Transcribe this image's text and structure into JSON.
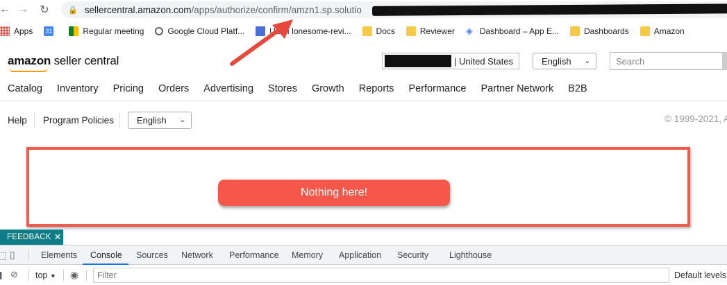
{
  "browser": {
    "url_host": "sellercentral.amazon.com",
    "url_path": "/apps/authorize/confirm/amzn1.sp.solutio"
  },
  "bookmarks": [
    {
      "label": "Apps",
      "icon": "apps-grid-icon"
    },
    {
      "label": "",
      "icon": "calendar-icon"
    },
    {
      "label": "Regular meeting",
      "icon": "google-meet-icon"
    },
    {
      "label": "Google Cloud Platf...",
      "icon": "google-cloud-icon"
    },
    {
      "label": "USUI lonesome-revi...",
      "icon": "usui-icon"
    },
    {
      "label": "Docs",
      "icon": "folder-icon"
    },
    {
      "label": "Reviewer",
      "icon": "folder-icon"
    },
    {
      "label": "Dashboard – App E...",
      "icon": "app-engine-icon"
    },
    {
      "label": "Dashboards",
      "icon": "folder-icon"
    },
    {
      "label": "Amazon",
      "icon": "folder-icon"
    }
  ],
  "header": {
    "logo_bold": "amazon",
    "logo_rest": " seller central",
    "store_country": "| United States",
    "language": "English",
    "search_placeholder": "Search"
  },
  "nav": [
    "Catalog",
    "Inventory",
    "Pricing",
    "Orders",
    "Advertising",
    "Stores",
    "Growth",
    "Reports",
    "Performance",
    "Partner Network",
    "B2B"
  ],
  "subbar": {
    "help": "Help",
    "program_policies": "Program Policies",
    "language": "English",
    "copyright": "© 1999-2021, A"
  },
  "main": {
    "empty_message": "Nothing here!"
  },
  "feedback": {
    "label": "FEEDBACK",
    "close": "✕"
  },
  "devtools": {
    "tabs": [
      "Elements",
      "Console",
      "Sources",
      "Network",
      "Performance",
      "Memory",
      "Application",
      "Security",
      "Lighthouse"
    ],
    "active_tab": "Console",
    "context": "top",
    "filter_placeholder": "Filter",
    "levels": "Default levels"
  },
  "colors": {
    "highlight_red": "#ee5a4c",
    "feedback_teal": "#0f7c87",
    "devtools_active": "#1a73e8"
  }
}
